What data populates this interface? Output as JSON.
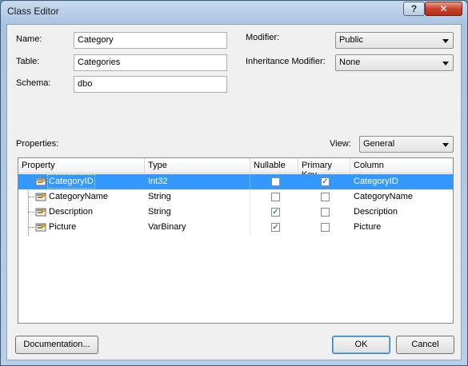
{
  "window": {
    "title": "Class Editor",
    "help_label": "?",
    "close_label": "✕"
  },
  "form": {
    "name_label": "Name:",
    "name_value": "Category",
    "table_label": "Table:",
    "table_value": "Categories",
    "schema_label": "Schema:",
    "schema_value": "dbo",
    "modifier_label": "Modifier:",
    "modifier_value": "Public",
    "inheritance_label": "Inheritance Modifier:",
    "inheritance_value": "None"
  },
  "properties": {
    "label": "Properties:",
    "view_label": "View:",
    "view_value": "General",
    "columns": [
      "Property",
      "Type",
      "Nullable",
      "Primary Key",
      "Column"
    ],
    "rows": [
      {
        "property": "CategoryID",
        "type": "Int32",
        "nullable": false,
        "primary_key": true,
        "column": "CategoryID",
        "selected": true
      },
      {
        "property": "CategoryName",
        "type": "String",
        "nullable": false,
        "primary_key": false,
        "column": "CategoryName",
        "selected": false
      },
      {
        "property": "Description",
        "type": "String",
        "nullable": true,
        "primary_key": false,
        "column": "Description",
        "selected": false
      },
      {
        "property": "Picture",
        "type": "VarBinary",
        "nullable": true,
        "primary_key": false,
        "column": "Picture",
        "selected": false
      }
    ]
  },
  "buttons": {
    "documentation": "Documentation...",
    "ok": "OK",
    "cancel": "Cancel"
  },
  "colors": {
    "selection": "#3399ff",
    "title_bar": "#a7c3e2",
    "close_button": "#c7432b"
  }
}
